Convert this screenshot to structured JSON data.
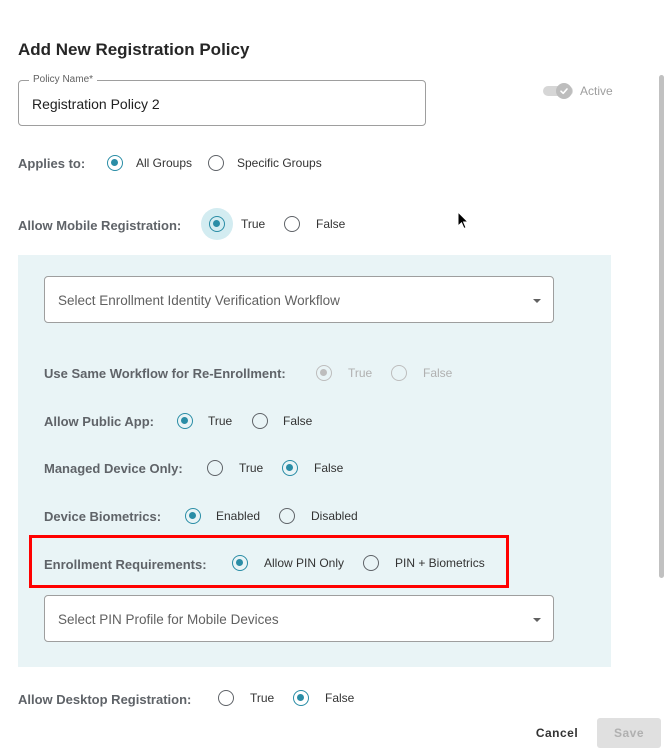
{
  "dialog": {
    "title": "Add New Registration Policy",
    "policy_name": {
      "label": "Policy Name*",
      "value": "Registration Policy 2"
    },
    "active": {
      "label": "Active",
      "on": true,
      "disabled": true
    },
    "applies_to": {
      "label": "Applies to:",
      "options": [
        "All Groups",
        "Specific Groups"
      ],
      "selected": "All Groups"
    },
    "allow_mobile_registration": {
      "label": "Allow Mobile Registration:",
      "options": [
        "True",
        "False"
      ],
      "selected": "True"
    },
    "mobile_panel": {
      "workflow_select": {
        "placeholder": "Select Enrollment Identity Verification Workflow"
      },
      "same_workflow": {
        "label": "Use Same Workflow for Re-Enrollment:",
        "options": [
          "True",
          "False"
        ],
        "selected": "True",
        "disabled": true
      },
      "allow_public_app": {
        "label": "Allow Public App:",
        "options": [
          "True",
          "False"
        ],
        "selected": "True"
      },
      "managed_device_only": {
        "label": "Managed Device Only:",
        "options": [
          "True",
          "False"
        ],
        "selected": "False"
      },
      "device_biometrics": {
        "label": "Device Biometrics:",
        "options": [
          "Enabled",
          "Disabled"
        ],
        "selected": "Enabled"
      },
      "enrollment_requirements": {
        "label": "Enrollment Requirements:",
        "options": [
          "Allow PIN Only",
          "PIN + Biometrics"
        ],
        "selected": "Allow PIN Only"
      },
      "pin_profile_select": {
        "placeholder": "Select PIN Profile for Mobile Devices"
      }
    },
    "allow_desktop_registration": {
      "label": "Allow Desktop Registration:",
      "options": [
        "True",
        "False"
      ],
      "selected": "False"
    },
    "footer": {
      "cancel_label": "Cancel",
      "save_label": "Save"
    }
  },
  "colors": {
    "accent": "#2a8da6",
    "panel_background": "#e9f4f6",
    "highlight_border": "#ff0000"
  }
}
